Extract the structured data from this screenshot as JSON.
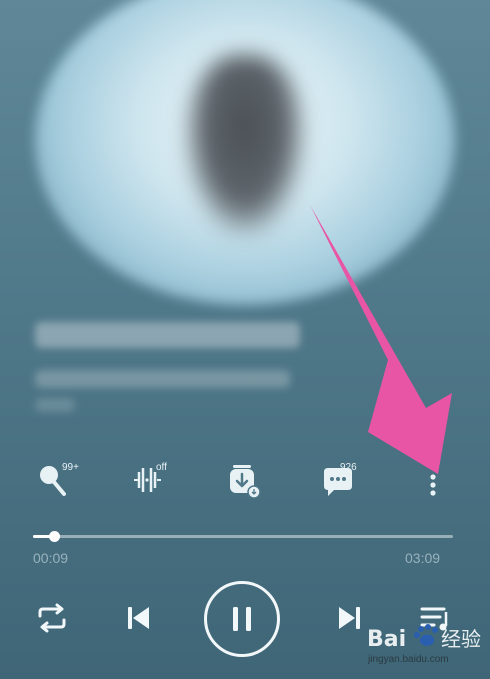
{
  "actions": {
    "voice_badge": "99+",
    "effect_badge": "off",
    "comment_badge": "926"
  },
  "player": {
    "current_time": "00:09",
    "total_time": "03:09",
    "progress": 0.05
  },
  "watermark": {
    "line1": "Bai",
    "line2": "经验",
    "url": "jingyan.baidu.com"
  },
  "colors": {
    "accent_arrow": "#e855a5",
    "icon": "#e8f2f5"
  }
}
